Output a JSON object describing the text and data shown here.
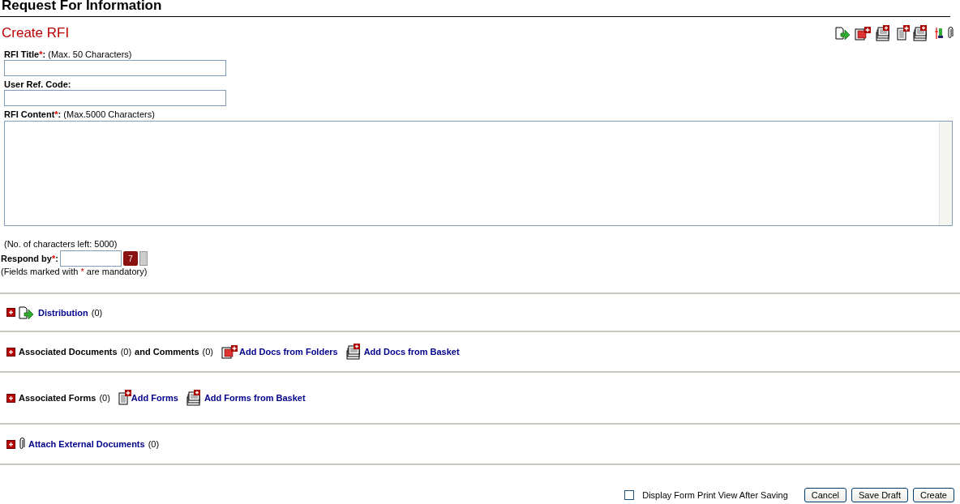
{
  "page_title": "Request For Information",
  "form_title": "Create RFI",
  "fields": [
    {
      "label": "RFI Title",
      "required_mark": "*",
      "colon": ":",
      "hint": "(Max. 50 Characters)",
      "kind": "text"
    },
    {
      "label": "User Ref. Code",
      "colon": ":",
      "kind": "text"
    },
    {
      "label": "RFI Content",
      "required_mark": "*",
      "colon": ":",
      "hint": "(Max.5000 Characters)",
      "kind": "textarea"
    }
  ],
  "chars_left": "(No. of characters left: 5000)",
  "respond_by": {
    "label": "Respond by",
    "required_mark": "*",
    "colon": ":",
    "calendar_day": "7"
  },
  "mandatory_note": {
    "before": "(Fields marked with",
    "mark": "*",
    "after": "are mandatory)"
  },
  "sections": [
    {
      "expanded": false,
      "parts": [
        {
          "kind": "link",
          "text": "Distribution"
        },
        {
          "kind": "count",
          "text": "(0)"
        }
      ]
    },
    {
      "expanded": false,
      "parts": [
        {
          "kind": "label",
          "text": "Associated Documents"
        },
        {
          "kind": "count",
          "text": "(0)"
        },
        {
          "kind": "label",
          "text": "and Comments"
        },
        {
          "kind": "count",
          "text": "(0)"
        },
        {
          "kind": "action",
          "text": "Add Docs from Folders"
        },
        {
          "kind": "action",
          "text": "Add Docs from Basket"
        }
      ]
    },
    {
      "expanded": false,
      "parts": [
        {
          "kind": "label",
          "text": "Associated Forms"
        },
        {
          "kind": "count",
          "text": "(0)"
        },
        {
          "kind": "action",
          "text": "Add Forms"
        },
        {
          "kind": "action",
          "text": "Add Forms from Basket"
        }
      ]
    },
    {
      "expanded": false,
      "parts": [
        {
          "kind": "link",
          "text": "Attach External Documents"
        },
        {
          "kind": "count",
          "text": "(0)"
        }
      ]
    }
  ],
  "print_option": {
    "label": "Display Form Print View After Saving",
    "checked": false
  },
  "buttons": [
    "Cancel",
    "Save Draft",
    "Create"
  ]
}
